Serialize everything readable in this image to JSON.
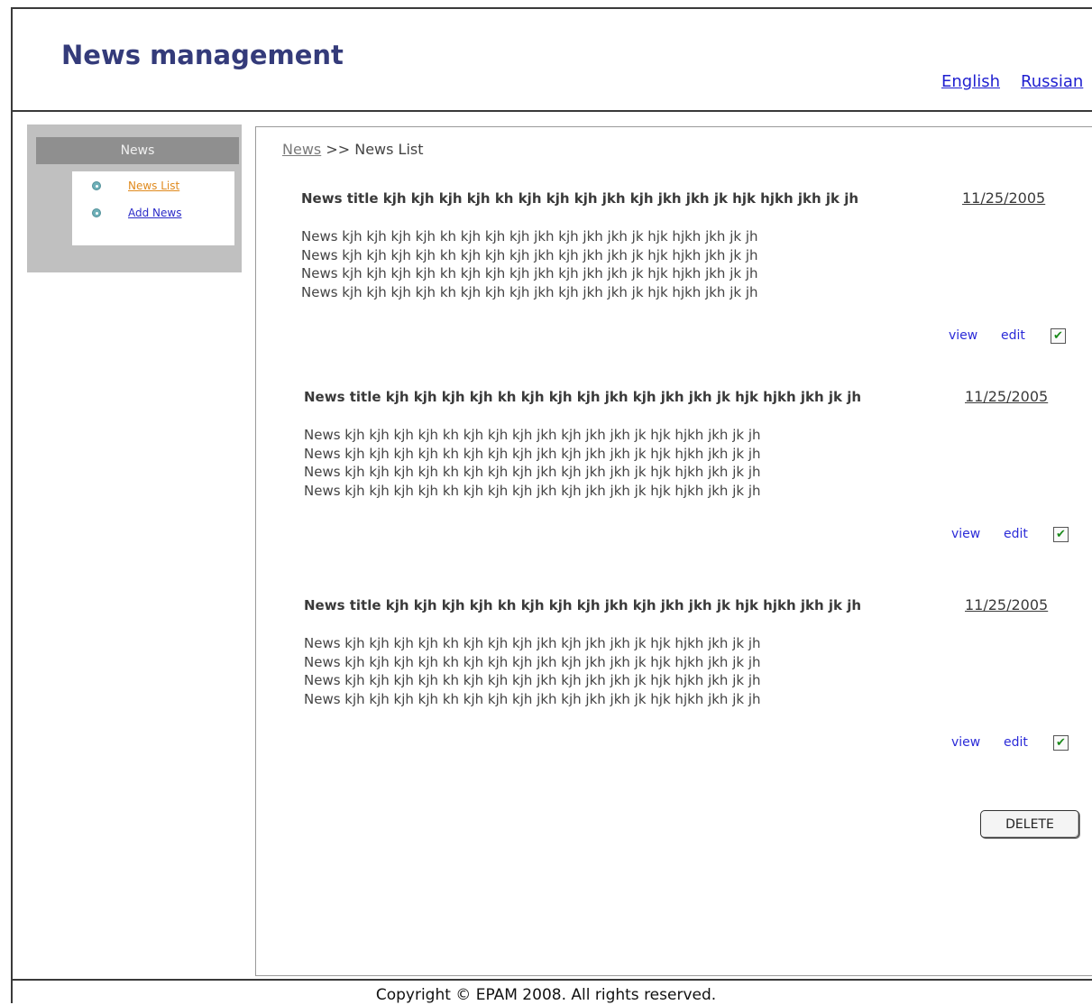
{
  "header": {
    "title": "News management",
    "languages": [
      "English",
      "Russian"
    ]
  },
  "sidebar": {
    "title": "News",
    "items": [
      {
        "label": "News List",
        "active": true,
        "color": "#e08a1e"
      },
      {
        "label": "Add News",
        "active": false,
        "color": "#2b2bc8"
      }
    ]
  },
  "breadcrumb": {
    "link": "News",
    "separator": ">>",
    "current": "News List"
  },
  "news": [
    {
      "title": "News title kjh kjh kjh kjh kh kjh kjh kjh jkh kjh jkh jkh jk hjk hjkh jkh jk jh",
      "date": "11/25/2005",
      "body": [
        "News kjh kjh kjh kjh kh kjh kjh kjh jkh kjh jkh jkh jk hjk hjkh jkh jk jh",
        "News kjh kjh kjh kjh kh kjh kjh kjh jkh kjh jkh jkh jk hjk hjkh jkh jk jh",
        "News kjh kjh kjh kjh kh kjh kjh kjh jkh kjh jkh jkh jk hjk hjkh jkh jk jh",
        "News kjh kjh kjh kjh kh kjh kjh kjh jkh kjh jkh jkh jk hjk hjkh jkh jk jh"
      ],
      "view_label": "view",
      "edit_label": "edit",
      "checked": true
    },
    {
      "title": "News title kjh kjh kjh kjh kh kjh kjh kjh jkh kjh jkh jkh jk hjk hjkh jkh jk jh",
      "date": "11/25/2005",
      "body": [
        "News kjh kjh kjh kjh kh kjh kjh kjh jkh kjh jkh jkh jk hjk hjkh jkh jk jh",
        "News kjh kjh kjh kjh kh kjh kjh kjh jkh kjh jkh jkh jk hjk hjkh jkh jk jh",
        "News kjh kjh kjh kjh kh kjh kjh kjh jkh kjh jkh jkh jk hjk hjkh jkh jk jh",
        "News kjh kjh kjh kjh kh kjh kjh kjh jkh kjh jkh jkh jk hjk hjkh jkh jk jh"
      ],
      "view_label": "view",
      "edit_label": "edit",
      "checked": true
    },
    {
      "title": "News title kjh kjh kjh kjh kh kjh kjh kjh jkh kjh jkh jkh jk hjk hjkh jkh jk jh",
      "date": "11/25/2005",
      "body": [
        "News kjh kjh kjh kjh kh kjh kjh kjh jkh kjh jkh jkh jk hjk hjkh jkh jk jh",
        "News kjh kjh kjh kjh kh kjh kjh kjh jkh kjh jkh jkh jk hjk hjkh jkh jk jh",
        "News kjh kjh kjh kjh kh kjh kjh kjh jkh kjh jkh jkh jk hjk hjkh jkh jk jh",
        "News kjh kjh kjh kjh kh kjh kjh kjh jkh kjh jkh jkh jk hjk hjkh jkh jk jh"
      ],
      "view_label": "view",
      "edit_label": "edit",
      "checked": true
    }
  ],
  "actions": {
    "delete_label": "DELETE"
  },
  "footer": {
    "copyright": "Copyright © EPAM 2008. All rights reserved."
  },
  "colors": {
    "title": "#343b7a",
    "link": "#1f1fd0",
    "sidebar_bg": "#c0c0c0",
    "sidebar_header_bg": "#8f8f8f",
    "check": "#1b8a1b"
  },
  "icons": {
    "bullet": "circle-bullet-icon",
    "check": "checkmark-icon"
  }
}
